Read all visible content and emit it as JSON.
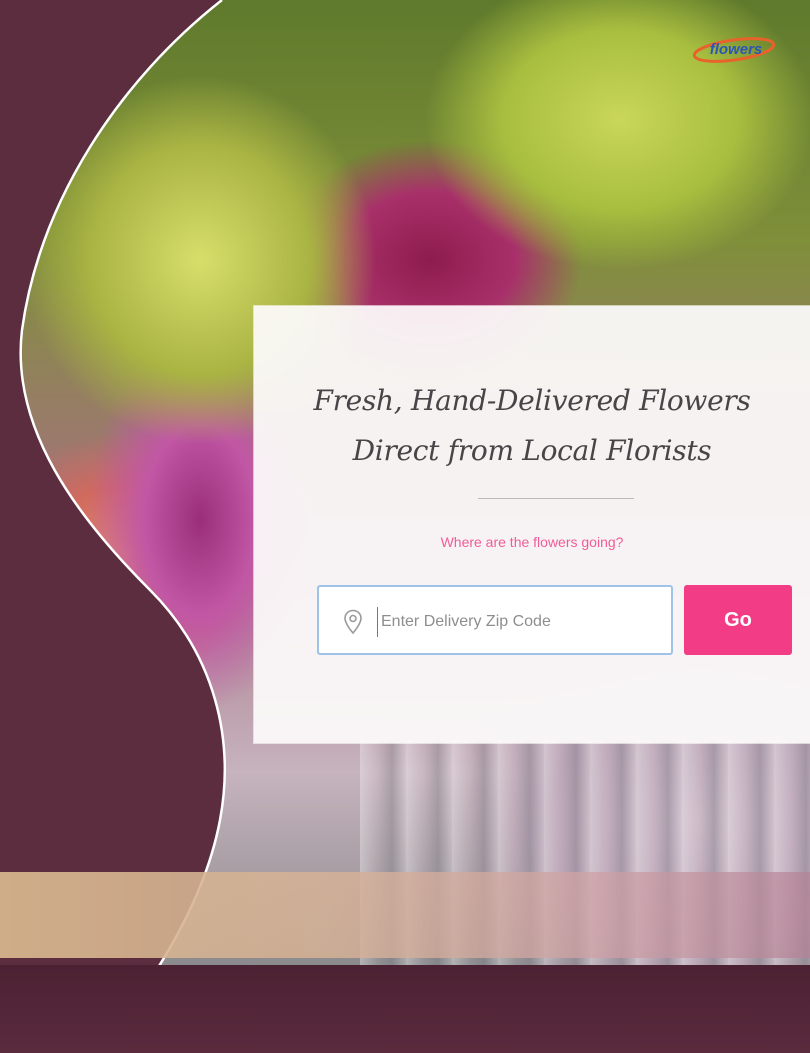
{
  "hero": {
    "headline_line1": "Fresh, Hand-Delivered Flowers",
    "headline_line2": "Direct from Local Florists",
    "question": "Where are the flowers going?"
  },
  "search": {
    "zip_placeholder": "Enter Delivery Zip Code",
    "zip_value": "",
    "go_label": "Go"
  },
  "icons": {
    "location": "location-pin-icon",
    "logo": "brand-logo"
  },
  "colors": {
    "accent": "#f23d86",
    "question_text": "#ef5d98",
    "field_border": "#9fc3e6",
    "frame_maroon": "#5a2e3d",
    "tan_stripe": "#d6b48c"
  }
}
